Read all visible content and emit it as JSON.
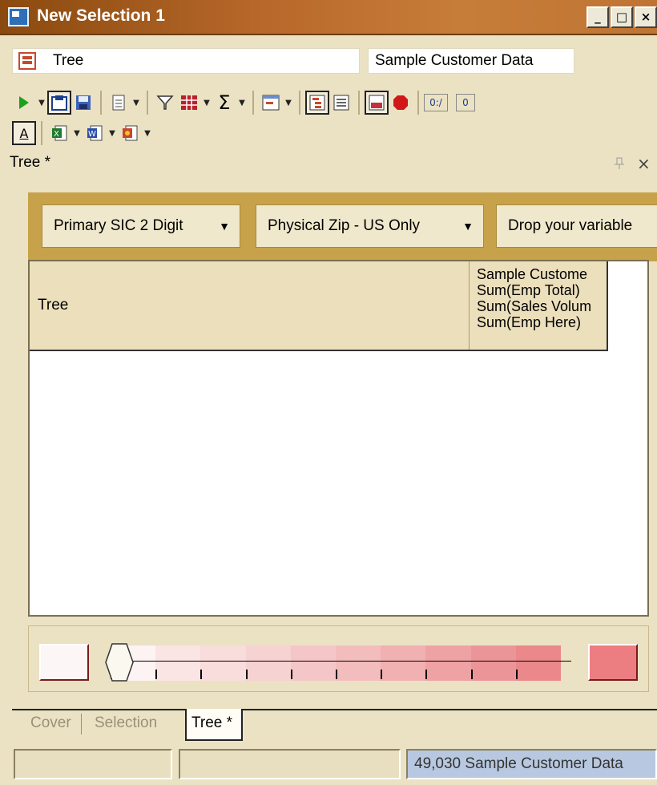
{
  "window": {
    "title": "New Selection 1",
    "min_label": "_",
    "max_label": "□",
    "close_label": "×"
  },
  "selector": {
    "tree_value": "Tree",
    "data_value": "Sample Customer Data"
  },
  "toolbar": {
    "icons": [
      "run-icon",
      "clipboard-icon",
      "save-icon",
      "notes-icon",
      "filter-icon",
      "grid-icon",
      "sum-icon",
      "window-icon",
      "tree-view-icon",
      "list-view-icon",
      "color-bar-icon",
      "stop-icon",
      "label-icon",
      "zero-icon",
      "font-icon",
      "excel-icon",
      "word-icon",
      "powerpoint-icon"
    ],
    "label_0": "0:/",
    "label_1": "0"
  },
  "panel": {
    "title": "Tree *",
    "pin": "ᵖ",
    "close": "×"
  },
  "dropzone": {
    "chips": [
      "Primary SIC 2 Digit",
      "Physical Zip - US Only",
      "Drop your variable"
    ],
    "arrow": "▼"
  },
  "grid": {
    "col_tree": "Tree",
    "col_values": [
      "Sample Custome",
      "Sum(Emp Total)",
      "Sum(Sales Volum",
      "Sum(Emp Here)"
    ]
  },
  "legend": {
    "low_color": "#fdf6f6",
    "high_color": "#ec7d80"
  },
  "tabs": {
    "items": [
      "Cover",
      "Selection",
      "Tree *"
    ],
    "active": "Tree *"
  },
  "status": {
    "left": "",
    "middle": "",
    "right": "49,030 Sample Customer Data"
  }
}
